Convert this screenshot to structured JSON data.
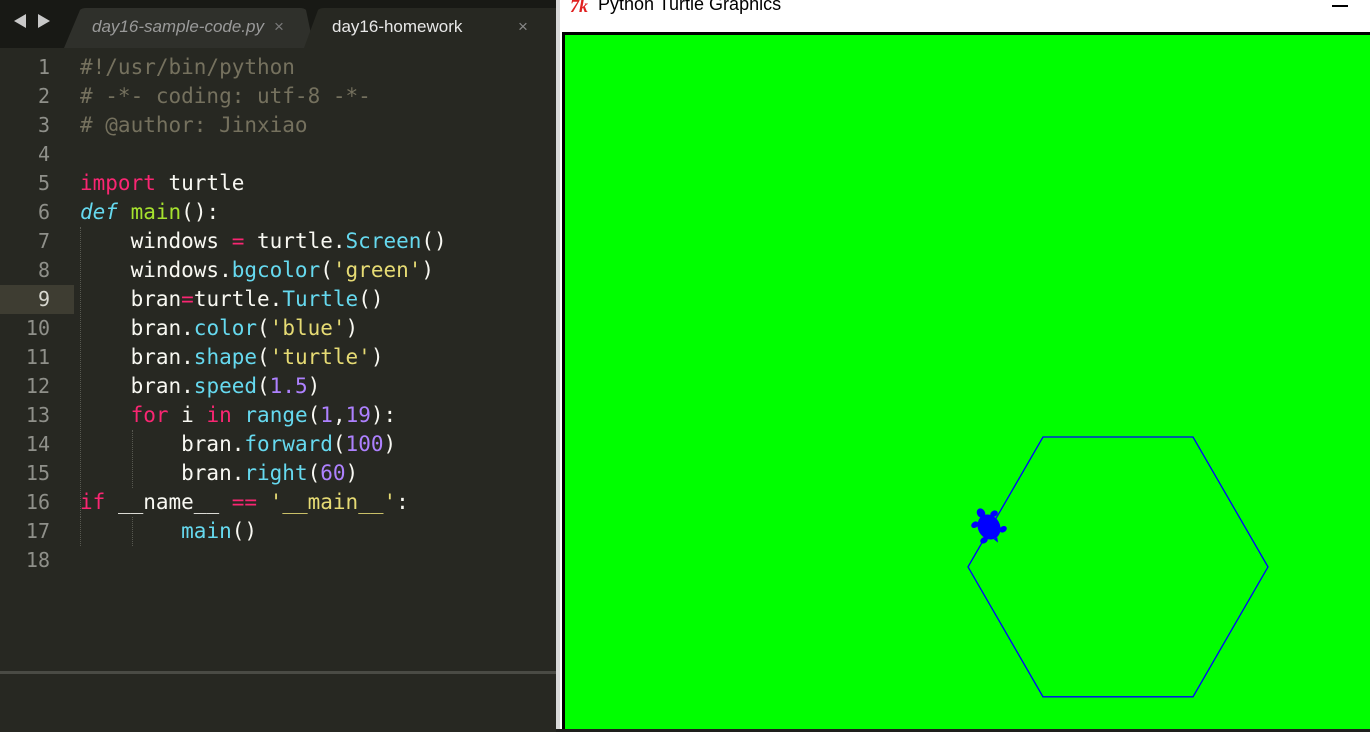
{
  "editor": {
    "tabs": [
      {
        "label": "day16-sample-code.py",
        "close": "×",
        "active": false
      },
      {
        "label": "day16-homework",
        "close": "×",
        "active": true
      }
    ],
    "current_line": 9,
    "lines": [
      {
        "n": "1",
        "tokens": [
          {
            "t": "#!/usr/bin/python",
            "c": "cm"
          }
        ]
      },
      {
        "n": "2",
        "tokens": [
          {
            "t": "# -*- coding: utf-8 -*-",
            "c": "cm"
          }
        ]
      },
      {
        "n": "3",
        "tokens": [
          {
            "t": "# @author: Jinxiao",
            "c": "cm"
          }
        ]
      },
      {
        "n": "4",
        "tokens": []
      },
      {
        "n": "5",
        "tokens": [
          {
            "t": "import",
            "c": "kw"
          },
          {
            "t": " turtle",
            "c": ""
          }
        ]
      },
      {
        "n": "6",
        "tokens": [
          {
            "t": "def",
            "c": "st"
          },
          {
            "t": " ",
            "c": ""
          },
          {
            "t": "main",
            "c": "fn"
          },
          {
            "t": "():",
            "c": ""
          }
        ]
      },
      {
        "n": "7",
        "tokens": [
          {
            "t": "    windows ",
            "c": ""
          },
          {
            "t": "=",
            "c": "op"
          },
          {
            "t": " turtle.",
            "c": ""
          },
          {
            "t": "Screen",
            "c": "bi"
          },
          {
            "t": "()",
            "c": ""
          }
        ]
      },
      {
        "n": "8",
        "tokens": [
          {
            "t": "    windows.",
            "c": ""
          },
          {
            "t": "bgcolor",
            "c": "bi"
          },
          {
            "t": "(",
            "c": ""
          },
          {
            "t": "'green'",
            "c": "str"
          },
          {
            "t": ")",
            "c": ""
          }
        ]
      },
      {
        "n": "9",
        "tokens": [
          {
            "t": "    bran",
            "c": ""
          },
          {
            "t": "=",
            "c": "op"
          },
          {
            "t": "turtle.",
            "c": ""
          },
          {
            "t": "Turtle",
            "c": "bi"
          },
          {
            "t": "()",
            "c": ""
          }
        ]
      },
      {
        "n": "10",
        "tokens": [
          {
            "t": "    bran.",
            "c": ""
          },
          {
            "t": "color",
            "c": "bi"
          },
          {
            "t": "(",
            "c": ""
          },
          {
            "t": "'blue'",
            "c": "str"
          },
          {
            "t": ")",
            "c": ""
          }
        ]
      },
      {
        "n": "11",
        "tokens": [
          {
            "t": "    bran.",
            "c": ""
          },
          {
            "t": "shape",
            "c": "bi"
          },
          {
            "t": "(",
            "c": ""
          },
          {
            "t": "'turtle'",
            "c": "str"
          },
          {
            "t": ")",
            "c": ""
          }
        ]
      },
      {
        "n": "12",
        "tokens": [
          {
            "t": "    bran.",
            "c": ""
          },
          {
            "t": "speed",
            "c": "bi"
          },
          {
            "t": "(",
            "c": ""
          },
          {
            "t": "1.5",
            "c": "num"
          },
          {
            "t": ")",
            "c": ""
          }
        ]
      },
      {
        "n": "13",
        "tokens": [
          {
            "t": "    ",
            "c": ""
          },
          {
            "t": "for",
            "c": "kw"
          },
          {
            "t": " i ",
            "c": ""
          },
          {
            "t": "in",
            "c": "kw"
          },
          {
            "t": " ",
            "c": ""
          },
          {
            "t": "range",
            "c": "bi"
          },
          {
            "t": "(",
            "c": ""
          },
          {
            "t": "1",
            "c": "num"
          },
          {
            "t": ",",
            "c": ""
          },
          {
            "t": "19",
            "c": "num"
          },
          {
            "t": "):",
            "c": ""
          }
        ]
      },
      {
        "n": "14",
        "tokens": [
          {
            "t": "        bran.",
            "c": ""
          },
          {
            "t": "forward",
            "c": "bi"
          },
          {
            "t": "(",
            "c": ""
          },
          {
            "t": "100",
            "c": "num"
          },
          {
            "t": ")",
            "c": ""
          }
        ]
      },
      {
        "n": "15",
        "tokens": [
          {
            "t": "        bran.",
            "c": ""
          },
          {
            "t": "right",
            "c": "bi"
          },
          {
            "t": "(",
            "c": ""
          },
          {
            "t": "60",
            "c": "num"
          },
          {
            "t": ")",
            "c": ""
          }
        ]
      },
      {
        "n": "16",
        "tokens": [
          {
            "t": "if",
            "c": "kw"
          },
          {
            "t": " __name__ ",
            "c": ""
          },
          {
            "t": "==",
            "c": "op"
          },
          {
            "t": " ",
            "c": ""
          },
          {
            "t": "'__main__'",
            "c": "str"
          },
          {
            "t": ":",
            "c": ""
          }
        ]
      },
      {
        "n": "17",
        "tokens": [
          {
            "t": "        ",
            "c": ""
          },
          {
            "t": "main",
            "c": "bi"
          },
          {
            "t": "()",
            "c": ""
          }
        ]
      },
      {
        "n": "18",
        "tokens": []
      }
    ]
  },
  "turtle_window": {
    "logo": "7k",
    "title": "Python Turtle Graphics",
    "background_color": "#00ff00",
    "pen_color": "#0000ff",
    "drawing": {
      "shape": "hexagon",
      "side_length": 100,
      "turn_angle": 60,
      "repetitions": 18
    }
  },
  "colors": {
    "editor_bg": "#272822",
    "canvas_bg": "#00ff00",
    "pen": "#0000ff"
  }
}
